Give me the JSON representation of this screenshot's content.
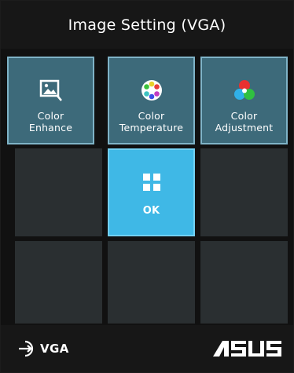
{
  "window": {
    "title": "Image Setting (VGA)"
  },
  "tiles": [
    {
      "label": "Color\nEnhance",
      "icon": "picture-icon"
    },
    {
      "label": "Color\nTemperature",
      "icon": "color-wheel-icon"
    },
    {
      "label": "Color\nAdjustment",
      "icon": "rgb-circles-icon"
    },
    {
      "label": "OK",
      "icon": "grid-icon"
    }
  ],
  "footer": {
    "input_label": "VGA",
    "input_icon": "input-source-icon",
    "brand": "ASUS"
  },
  "colors": {
    "menu_tile": "#3d6a7a",
    "selected_tile": "#3fb8e6",
    "empty_tile": "#2a2f31"
  }
}
